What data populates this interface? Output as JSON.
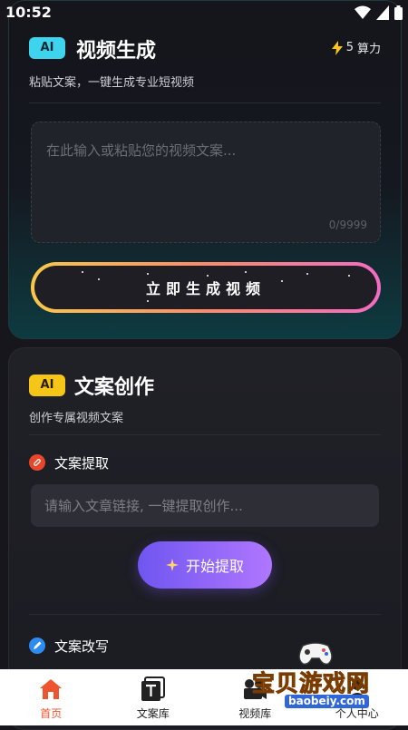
{
  "status_bar": {
    "time": "10:52"
  },
  "video_gen": {
    "badge": "AI",
    "title": "视频生成",
    "power_value": "5",
    "power_unit": "算力",
    "subtitle": "粘贴文案，一键生成专业短视频",
    "textarea_placeholder": "在此输入或粘贴您的视频文案...",
    "char_count": "0/9999",
    "generate_label": "立即生成视频"
  },
  "copywriting": {
    "badge": "AI",
    "title": "文案创作",
    "subtitle": "创作专属视频文案",
    "extract_section": "文案提取",
    "input_placeholder": "请输入文章链接, 一键提取创作...",
    "extract_button": "开始提取",
    "rewrite_section": "文案改写"
  },
  "bottom_nav": [
    {
      "label": "首页",
      "icon": "home-icon",
      "active": true
    },
    {
      "label": "文案库",
      "icon": "text-library-icon",
      "active": false
    },
    {
      "label": "视频库",
      "icon": "video-library-icon",
      "active": false
    },
    {
      "label": "个人中心",
      "icon": "profile-icon",
      "active": false
    }
  ],
  "watermark": {
    "title": "宝贝游戏网",
    "url": "baobeiy.com"
  },
  "colors": {
    "accent_orange": "#f0532f",
    "badge_cyan": "#3fd4ee",
    "badge_yellow": "#f5c518",
    "button_purple": "#8a63f5"
  }
}
